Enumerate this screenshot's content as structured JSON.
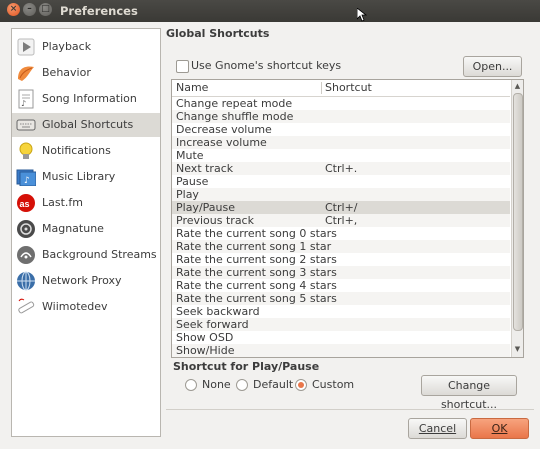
{
  "window": {
    "title": "Preferences",
    "close_glyph": "×",
    "min_glyph": "–",
    "max_glyph": "□"
  },
  "sidebar": {
    "items": [
      {
        "label": "Playback",
        "icon": "playback-icon"
      },
      {
        "label": "Behavior",
        "icon": "behavior-icon"
      },
      {
        "label": "Song Information",
        "icon": "song-information-icon"
      },
      {
        "label": "Global Shortcuts",
        "icon": "keyboard-icon",
        "selected": true
      },
      {
        "label": "Notifications",
        "icon": "lightbulb-icon"
      },
      {
        "label": "Music Library",
        "icon": "music-library-icon"
      },
      {
        "label": "Last.fm",
        "icon": "lastfm-icon"
      },
      {
        "label": "Magnatune",
        "icon": "magnatune-icon"
      },
      {
        "label": "Background Streams",
        "icon": "background-streams-icon"
      },
      {
        "label": "Network Proxy",
        "icon": "network-proxy-icon"
      },
      {
        "label": "Wiimotedev",
        "icon": "wiimote-icon"
      }
    ]
  },
  "main": {
    "section_title": "Global Shortcuts",
    "use_gnome_label": "Use Gnome's shortcut keys",
    "use_gnome_checked": false,
    "open_button": "Open...",
    "table": {
      "columns": [
        "Name",
        "Shortcut"
      ],
      "rows": [
        {
          "name": "Change repeat mode",
          "shortcut": ""
        },
        {
          "name": "Change shuffle mode",
          "shortcut": ""
        },
        {
          "name": "Decrease volume",
          "shortcut": ""
        },
        {
          "name": "Increase volume",
          "shortcut": ""
        },
        {
          "name": "Mute",
          "shortcut": ""
        },
        {
          "name": "Next track",
          "shortcut": "Ctrl+."
        },
        {
          "name": "Pause",
          "shortcut": ""
        },
        {
          "name": "Play",
          "shortcut": ""
        },
        {
          "name": "Play/Pause",
          "shortcut": "Ctrl+/",
          "selected": true
        },
        {
          "name": "Previous track",
          "shortcut": "Ctrl+,"
        },
        {
          "name": "Rate the current song 0 stars",
          "shortcut": ""
        },
        {
          "name": "Rate the current song 1 star",
          "shortcut": ""
        },
        {
          "name": "Rate the current song 2 stars",
          "shortcut": ""
        },
        {
          "name": "Rate the current song 3 stars",
          "shortcut": ""
        },
        {
          "name": "Rate the current song 4 stars",
          "shortcut": ""
        },
        {
          "name": "Rate the current song 5 stars",
          "shortcut": ""
        },
        {
          "name": "Seek backward",
          "shortcut": ""
        },
        {
          "name": "Seek forward",
          "shortcut": ""
        },
        {
          "name": "Show OSD",
          "shortcut": ""
        },
        {
          "name": "Show/Hide",
          "shortcut": ""
        }
      ]
    },
    "shortcut_for_title": "Shortcut for Play/Pause",
    "radio": {
      "none": "None",
      "default": "Default",
      "custom": "Custom",
      "selected": "custom"
    },
    "change_shortcut_button": "Change shortcut...",
    "cancel_button": "Cancel",
    "ok_button": "OK"
  },
  "colors": {
    "accent": "#e9764a",
    "titlebar": "#3c3b37",
    "selection": "#dcdad5"
  }
}
